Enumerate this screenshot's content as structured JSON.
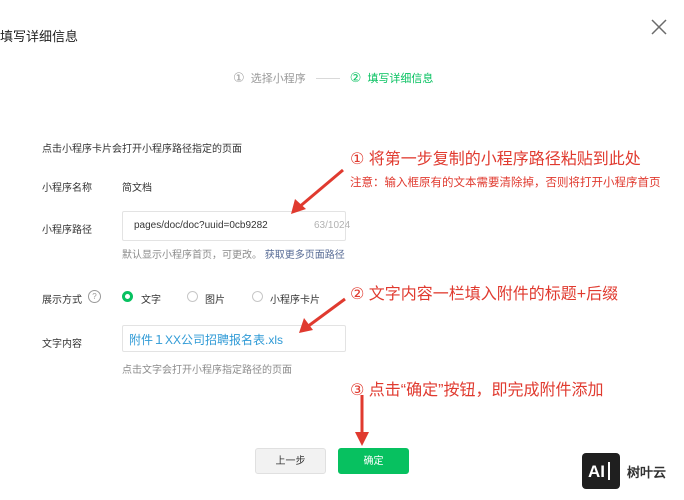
{
  "dialog": {
    "title": "填写详细信息",
    "steps": [
      {
        "num": "①",
        "label": "选择小程序"
      },
      {
        "num": "②",
        "label": "填写详细信息"
      }
    ]
  },
  "form": {
    "description": "点击小程序卡片会打开小程序路径指定的页面",
    "name_label": "小程序名称",
    "name_value": "简文档",
    "path_label": "小程序路径",
    "path_value": "pages/doc/doc?uuid=0cb9282",
    "path_counter": "63/1024",
    "path_hint": "默认显示小程序首页，可更改。",
    "path_hint_link": "获取更多页面路径",
    "display_label": "展示方式",
    "display_help": "?",
    "display_options": [
      {
        "label": "文字",
        "selected": true
      },
      {
        "label": "图片",
        "selected": false
      },
      {
        "label": "小程序卡片",
        "selected": false
      }
    ],
    "text_label": "文字内容",
    "text_value": "附件１XX公司招聘报名表.xls",
    "text_hint": "点击文字会打开小程序指定路径的页面"
  },
  "annotations": {
    "a1": "① 将第一步复制的小程序路径粘贴到此处",
    "a1_note": "注意：输入框原有的文本需要清除掉，否则将打开小程序首页",
    "a2": "② 文字内容一栏填入附件的标题+后缀",
    "a3": "③ 点击“确定”按钮，即完成附件添加"
  },
  "buttons": {
    "prev": "上一步",
    "ok": "确定"
  },
  "watermark": {
    "logo_text": "AI",
    "name": "树叶云"
  },
  "colors": {
    "accent": "#07c160",
    "annotation": "#e03a2f",
    "link": "#576b95"
  }
}
